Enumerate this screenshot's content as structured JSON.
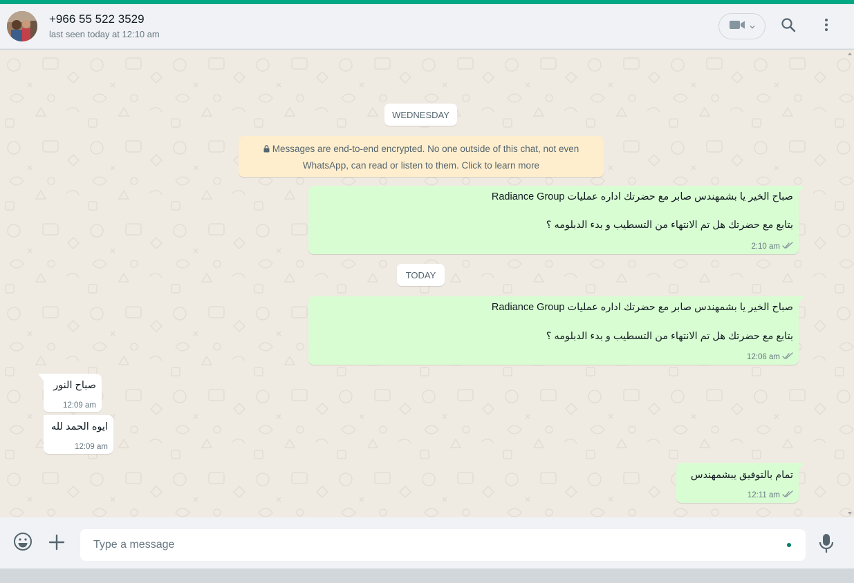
{
  "app": {
    "accent_color": "#00a884"
  },
  "header": {
    "contact_name": "+966 55 522 3529",
    "status": "last seen today at 12:10 am",
    "avatar_icon": "contact-photo",
    "video_icon": "video-camera-icon",
    "search_icon": "search-icon",
    "menu_icon": "kebab-menu-icon"
  },
  "chat": {
    "date_wednesday": "WEDNESDAY",
    "encryption_notice": {
      "line1": "Messages are end-to-end encrypted. No one outside of this chat, not even",
      "line2": "WhatsApp, can read or listen to them. Click to learn more"
    },
    "date_today": "TODAY",
    "messages": [
      {
        "direction": "out",
        "line1": "صباح الخير يا بشمهندس صابر مع  حضرتك اداره عمليات Radiance Group",
        "line2": "بتابع مع حضرتك هل تم الانتهاء من التسطيب و بدء الدبلومه ؟",
        "time": "2:10 am",
        "status": "delivered"
      },
      {
        "direction": "out",
        "line1": "صباح الخير يا بشمهندس صابر مع  حضرتك اداره عمليات Radiance Group",
        "line2": "بتابع مع حضرتك هل تم الانتهاء من التسطيب و بدء الدبلومه ؟",
        "time": "12:06 am",
        "status": "delivered"
      },
      {
        "direction": "in",
        "line1": "صباح النور",
        "time": "12:09 am"
      },
      {
        "direction": "in",
        "line1": "ايوه الحمد لله",
        "time": "12:09 am"
      },
      {
        "direction": "out",
        "line1": "تمام بالتوفيق يبشمهندس",
        "time": "12:11 am",
        "status": "delivered"
      }
    ]
  },
  "composer": {
    "placeholder": "Type a message",
    "emoji_icon": "emoji-icon",
    "attach_icon": "plus-icon",
    "mic_icon": "microphone-icon"
  }
}
